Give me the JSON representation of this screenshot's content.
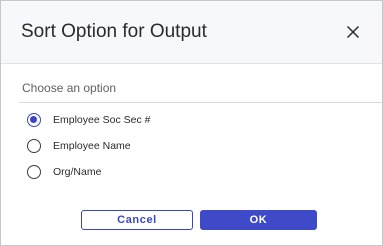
{
  "dialog": {
    "title": "Sort Option for Output",
    "close_icon": "close-x-icon"
  },
  "section": {
    "label": "Choose an option"
  },
  "options": [
    {
      "label": "Employee Soc Sec #",
      "selected": true
    },
    {
      "label": "Employee Name",
      "selected": false
    },
    {
      "label": "Org/Name",
      "selected": false
    }
  ],
  "buttons": {
    "cancel_label": "Cancel",
    "ok_label": "OK"
  },
  "colors": {
    "accent": "#3F4AC8",
    "header_bg": "#F7F8FC"
  }
}
